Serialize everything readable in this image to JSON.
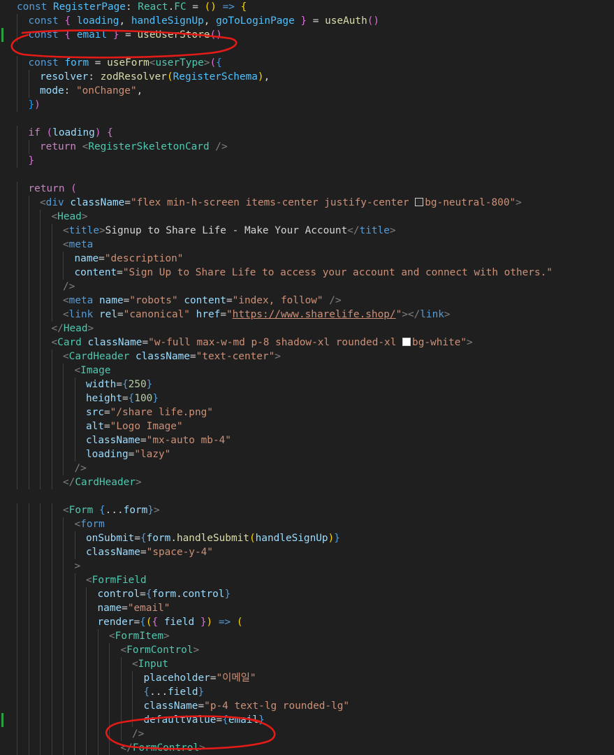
{
  "theme": {
    "background": "#1f1f1f",
    "annotation_color": "#e41b17",
    "modified_gutter_color": "#2ea043"
  },
  "annotations": [
    {
      "name": "red-circle-email-destructure",
      "around": "const { email } = useUserStore()"
    },
    {
      "name": "red-circle-default-value",
      "around": "defaultValue={email}"
    }
  ],
  "lines": [
    {
      "indent": 0,
      "tokens": [
        [
          "kw",
          "const "
        ],
        [
          "const",
          "RegisterPage"
        ],
        [
          "text",
          ": "
        ],
        [
          "type",
          "React"
        ],
        [
          "text",
          "."
        ],
        [
          "type",
          "FC"
        ],
        [
          "text",
          " = "
        ],
        [
          "p1",
          "()"
        ],
        [
          "kw",
          " =>"
        ],
        [
          "text",
          " "
        ],
        [
          "p1",
          "{"
        ]
      ]
    },
    {
      "indent": 1,
      "tokens": [
        [
          "kw",
          "const "
        ],
        [
          "p2",
          "{"
        ],
        [
          "text",
          " "
        ],
        [
          "const",
          "loading"
        ],
        [
          "text",
          ", "
        ],
        [
          "const",
          "handleSignUp"
        ],
        [
          "text",
          ", "
        ],
        [
          "const",
          "goToLoginPage"
        ],
        [
          "text",
          " "
        ],
        [
          "p2",
          "}"
        ],
        [
          "text",
          " = "
        ],
        [
          "fn",
          "useAuth"
        ],
        [
          "p2",
          "()"
        ]
      ]
    },
    {
      "indent": 1,
      "modified": true,
      "tokens": [
        [
          "kw",
          "const "
        ],
        [
          "p2",
          "{"
        ],
        [
          "text",
          " "
        ],
        [
          "const",
          "email"
        ],
        [
          "text",
          " "
        ],
        [
          "p2",
          "}"
        ],
        [
          "text",
          " = "
        ],
        [
          "fn",
          "useUserStore"
        ],
        [
          "p2",
          "()"
        ]
      ]
    },
    {
      "indent": 0,
      "tokens": []
    },
    {
      "indent": 1,
      "tokens": [
        [
          "kw",
          "const "
        ],
        [
          "const",
          "form"
        ],
        [
          "text",
          " = "
        ],
        [
          "fn",
          "useForm"
        ],
        [
          "punc",
          "<"
        ],
        [
          "type",
          "userType"
        ],
        [
          "punc",
          ">"
        ],
        [
          "p2",
          "("
        ],
        [
          "p3",
          "{"
        ]
      ]
    },
    {
      "indent": 2,
      "tokens": [
        [
          "var",
          "resolver"
        ],
        [
          "text",
          ": "
        ],
        [
          "fn",
          "zodResolver"
        ],
        [
          "p1",
          "("
        ],
        [
          "const",
          "RegisterSchema"
        ],
        [
          "p1",
          ")"
        ],
        [
          "text",
          ","
        ]
      ]
    },
    {
      "indent": 2,
      "tokens": [
        [
          "var",
          "mode"
        ],
        [
          "text",
          ": "
        ],
        [
          "str",
          "\"onChange\""
        ],
        [
          "text",
          ","
        ]
      ]
    },
    {
      "indent": 1,
      "tokens": [
        [
          "p3",
          "}"
        ],
        [
          "p2",
          ")"
        ]
      ]
    },
    {
      "indent": 0,
      "tokens": []
    },
    {
      "indent": 1,
      "tokens": [
        [
          "ctrl",
          "if "
        ],
        [
          "p2",
          "("
        ],
        [
          "var",
          "loading"
        ],
        [
          "p2",
          ")"
        ],
        [
          "text",
          " "
        ],
        [
          "p2",
          "{"
        ]
      ]
    },
    {
      "indent": 2,
      "tokens": [
        [
          "ctrl",
          "return "
        ],
        [
          "punc",
          "<"
        ],
        [
          "tag",
          "RegisterSkeletonCard"
        ],
        [
          "text",
          " "
        ],
        [
          "punc",
          "/>"
        ]
      ]
    },
    {
      "indent": 1,
      "tokens": [
        [
          "p2",
          "}"
        ]
      ]
    },
    {
      "indent": 0,
      "tokens": []
    },
    {
      "indent": 1,
      "tokens": [
        [
          "ctrl",
          "return "
        ],
        [
          "p2",
          "("
        ]
      ]
    },
    {
      "indent": 2,
      "tokens": [
        [
          "punc",
          "<"
        ],
        [
          "html",
          "div"
        ],
        [
          "text",
          " "
        ],
        [
          "attr",
          "className"
        ],
        [
          "text",
          "="
        ],
        [
          "str",
          "\"flex min-h-screen items-center justify-center "
        ],
        [
          "swatch",
          "#262626"
        ],
        [
          "str",
          "bg-neutral-800\""
        ],
        [
          "punc",
          ">"
        ]
      ]
    },
    {
      "indent": 3,
      "tokens": [
        [
          "punc",
          "<"
        ],
        [
          "tag",
          "Head"
        ],
        [
          "punc",
          ">"
        ]
      ]
    },
    {
      "indent": 4,
      "tokens": [
        [
          "punc",
          "<"
        ],
        [
          "html",
          "title"
        ],
        [
          "punc",
          ">"
        ],
        [
          "text",
          "Signup to Share Life - Make Your Account"
        ],
        [
          "punc",
          "</"
        ],
        [
          "html",
          "title"
        ],
        [
          "punc",
          ">"
        ]
      ]
    },
    {
      "indent": 4,
      "tokens": [
        [
          "punc",
          "<"
        ],
        [
          "html",
          "meta"
        ]
      ]
    },
    {
      "indent": 5,
      "tokens": [
        [
          "attr",
          "name"
        ],
        [
          "text",
          "="
        ],
        [
          "str",
          "\"description\""
        ]
      ]
    },
    {
      "indent": 5,
      "tokens": [
        [
          "attr",
          "content"
        ],
        [
          "text",
          "="
        ],
        [
          "str",
          "\"Sign Up to Share Life to access your account and connect with others.\""
        ]
      ]
    },
    {
      "indent": 4,
      "tokens": [
        [
          "punc",
          "/>"
        ]
      ]
    },
    {
      "indent": 4,
      "tokens": [
        [
          "punc",
          "<"
        ],
        [
          "html",
          "meta"
        ],
        [
          "text",
          " "
        ],
        [
          "attr",
          "name"
        ],
        [
          "text",
          "="
        ],
        [
          "str",
          "\"robots\""
        ],
        [
          "text",
          " "
        ],
        [
          "attr",
          "content"
        ],
        [
          "text",
          "="
        ],
        [
          "str",
          "\"index, follow\""
        ],
        [
          "text",
          " "
        ],
        [
          "punc",
          "/>"
        ]
      ]
    },
    {
      "indent": 4,
      "tokens": [
        [
          "punc",
          "<"
        ],
        [
          "html",
          "link"
        ],
        [
          "text",
          " "
        ],
        [
          "attr",
          "rel"
        ],
        [
          "text",
          "="
        ],
        [
          "str",
          "\"canonical\""
        ],
        [
          "text",
          " "
        ],
        [
          "attr",
          "href"
        ],
        [
          "text",
          "="
        ],
        [
          "str",
          "\""
        ],
        [
          "url",
          "https://www.sharelife.shop/"
        ],
        [
          "str",
          "\""
        ],
        [
          "punc",
          "></"
        ],
        [
          "html",
          "link"
        ],
        [
          "punc",
          ">"
        ]
      ]
    },
    {
      "indent": 3,
      "tokens": [
        [
          "punc",
          "</"
        ],
        [
          "tag",
          "Head"
        ],
        [
          "punc",
          ">"
        ]
      ]
    },
    {
      "indent": 3,
      "tokens": [
        [
          "punc",
          "<"
        ],
        [
          "tag",
          "Card"
        ],
        [
          "text",
          " "
        ],
        [
          "attr",
          "className"
        ],
        [
          "text",
          "="
        ],
        [
          "str",
          "\"w-full max-w-md p-8 shadow-xl rounded-xl "
        ],
        [
          "swatch",
          "#ffffff"
        ],
        [
          "str",
          "bg-white\""
        ],
        [
          "punc",
          ">"
        ]
      ]
    },
    {
      "indent": 4,
      "tokens": [
        [
          "punc",
          "<"
        ],
        [
          "tag",
          "CardHeader"
        ],
        [
          "text",
          " "
        ],
        [
          "attr",
          "className"
        ],
        [
          "text",
          "="
        ],
        [
          "str",
          "\"text-center\""
        ],
        [
          "punc",
          ">"
        ]
      ]
    },
    {
      "indent": 5,
      "tokens": [
        [
          "punc",
          "<"
        ],
        [
          "tag",
          "Image"
        ]
      ]
    },
    {
      "indent": 6,
      "tokens": [
        [
          "attr",
          "width"
        ],
        [
          "text",
          "="
        ],
        [
          "kw",
          "{"
        ],
        [
          "num",
          "250"
        ],
        [
          "kw",
          "}"
        ]
      ]
    },
    {
      "indent": 6,
      "tokens": [
        [
          "attr",
          "height"
        ],
        [
          "text",
          "="
        ],
        [
          "kw",
          "{"
        ],
        [
          "num",
          "100"
        ],
        [
          "kw",
          "}"
        ]
      ]
    },
    {
      "indent": 6,
      "tokens": [
        [
          "attr",
          "src"
        ],
        [
          "text",
          "="
        ],
        [
          "str",
          "\"/share life.png\""
        ]
      ]
    },
    {
      "indent": 6,
      "tokens": [
        [
          "attr",
          "alt"
        ],
        [
          "text",
          "="
        ],
        [
          "str",
          "\"Logo Image\""
        ]
      ]
    },
    {
      "indent": 6,
      "tokens": [
        [
          "attr",
          "className"
        ],
        [
          "text",
          "="
        ],
        [
          "str",
          "\"mx-auto mb-4\""
        ]
      ]
    },
    {
      "indent": 6,
      "tokens": [
        [
          "attr",
          "loading"
        ],
        [
          "text",
          "="
        ],
        [
          "str",
          "\"lazy\""
        ]
      ]
    },
    {
      "indent": 5,
      "tokens": [
        [
          "punc",
          "/>"
        ]
      ]
    },
    {
      "indent": 4,
      "tokens": [
        [
          "punc",
          "</"
        ],
        [
          "tag",
          "CardHeader"
        ],
        [
          "punc",
          ">"
        ]
      ]
    },
    {
      "indent": 0,
      "tokens": []
    },
    {
      "indent": 4,
      "tokens": [
        [
          "punc",
          "<"
        ],
        [
          "tag",
          "Form"
        ],
        [
          "text",
          " "
        ],
        [
          "kw",
          "{"
        ],
        [
          "text",
          "..."
        ],
        [
          "var",
          "form"
        ],
        [
          "kw",
          "}"
        ],
        [
          "punc",
          ">"
        ]
      ]
    },
    {
      "indent": 5,
      "tokens": [
        [
          "punc",
          "<"
        ],
        [
          "html",
          "form"
        ]
      ]
    },
    {
      "indent": 6,
      "tokens": [
        [
          "attr",
          "onSubmit"
        ],
        [
          "text",
          "="
        ],
        [
          "kw",
          "{"
        ],
        [
          "var",
          "form"
        ],
        [
          "text",
          "."
        ],
        [
          "fn",
          "handleSubmit"
        ],
        [
          "p1",
          "("
        ],
        [
          "var",
          "handleSignUp"
        ],
        [
          "p1",
          ")"
        ],
        [
          "kw",
          "}"
        ]
      ]
    },
    {
      "indent": 6,
      "tokens": [
        [
          "attr",
          "className"
        ],
        [
          "text",
          "="
        ],
        [
          "str",
          "\"space-y-4\""
        ]
      ]
    },
    {
      "indent": 5,
      "tokens": [
        [
          "punc",
          ">"
        ]
      ]
    },
    {
      "indent": 6,
      "tokens": [
        [
          "punc",
          "<"
        ],
        [
          "tag",
          "FormField"
        ]
      ]
    },
    {
      "indent": 7,
      "tokens": [
        [
          "attr",
          "control"
        ],
        [
          "text",
          "="
        ],
        [
          "kw",
          "{"
        ],
        [
          "var",
          "form"
        ],
        [
          "text",
          "."
        ],
        [
          "var",
          "control"
        ],
        [
          "kw",
          "}"
        ]
      ]
    },
    {
      "indent": 7,
      "tokens": [
        [
          "attr",
          "name"
        ],
        [
          "text",
          "="
        ],
        [
          "str",
          "\"email\""
        ]
      ]
    },
    {
      "indent": 7,
      "tokens": [
        [
          "attr",
          "render"
        ],
        [
          "text",
          "="
        ],
        [
          "kw",
          "{"
        ],
        [
          "p1",
          "("
        ],
        [
          "p2",
          "{"
        ],
        [
          "text",
          " "
        ],
        [
          "var",
          "field"
        ],
        [
          "text",
          " "
        ],
        [
          "p2",
          "}"
        ],
        [
          "p1",
          ")"
        ],
        [
          "kw",
          " =>"
        ],
        [
          "text",
          " "
        ],
        [
          "p1",
          "("
        ]
      ]
    },
    {
      "indent": 8,
      "tokens": [
        [
          "punc",
          "<"
        ],
        [
          "tag",
          "FormItem"
        ],
        [
          "punc",
          ">"
        ]
      ]
    },
    {
      "indent": 9,
      "tokens": [
        [
          "punc",
          "<"
        ],
        [
          "tag",
          "FormControl"
        ],
        [
          "punc",
          ">"
        ]
      ]
    },
    {
      "indent": 10,
      "tokens": [
        [
          "punc",
          "<"
        ],
        [
          "tag",
          "Input"
        ]
      ]
    },
    {
      "indent": 11,
      "tokens": [
        [
          "attr",
          "placeholder"
        ],
        [
          "text",
          "="
        ],
        [
          "str",
          "\"이메일\""
        ]
      ]
    },
    {
      "indent": 11,
      "tokens": [
        [
          "kw",
          "{"
        ],
        [
          "text",
          "..."
        ],
        [
          "var",
          "field"
        ],
        [
          "kw",
          "}"
        ]
      ]
    },
    {
      "indent": 11,
      "tokens": [
        [
          "attr",
          "className"
        ],
        [
          "text",
          "="
        ],
        [
          "str",
          "\"p-4 text-lg rounded-lg\""
        ]
      ]
    },
    {
      "indent": 11,
      "modified": true,
      "tokens": [
        [
          "attr",
          "defaultValue"
        ],
        [
          "text",
          "="
        ],
        [
          "kw",
          "{"
        ],
        [
          "var",
          "email"
        ],
        [
          "kw",
          "}"
        ]
      ]
    },
    {
      "indent": 10,
      "tokens": [
        [
          "punc",
          "/>"
        ]
      ]
    },
    {
      "indent": 9,
      "tokens": [
        [
          "punc",
          "</"
        ],
        [
          "tag",
          "FormControl"
        ],
        [
          "punc",
          ">"
        ]
      ]
    }
  ]
}
